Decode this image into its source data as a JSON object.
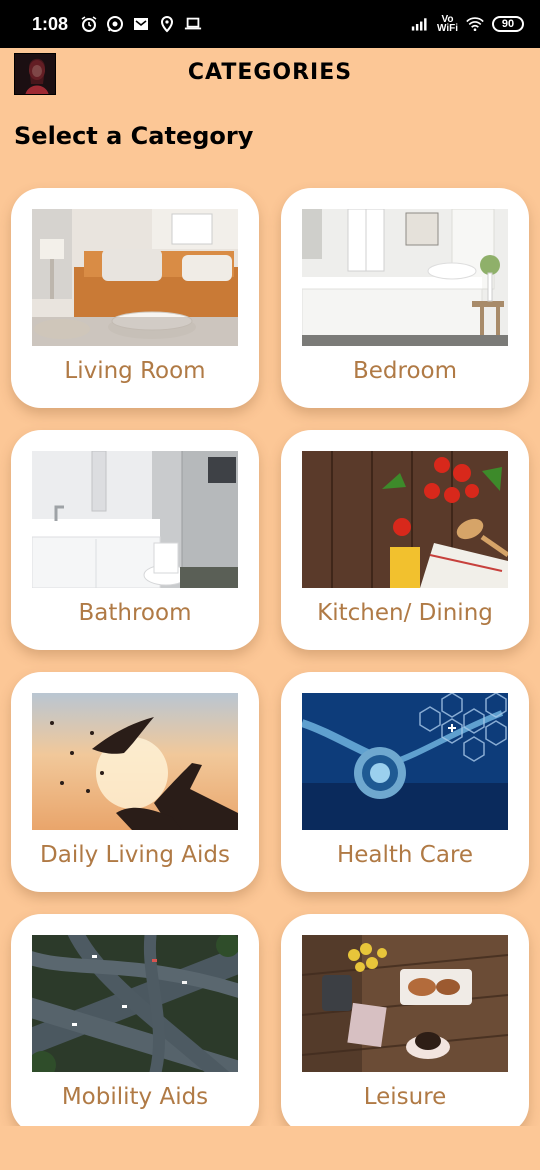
{
  "status_bar": {
    "time": "1:08",
    "volte_top": "Vo",
    "volte_bottom": "WiFi",
    "battery": "90"
  },
  "header": {
    "title": "CATEGORIES"
  },
  "section_title": "Select a Category",
  "categories": [
    {
      "label": "Living Room"
    },
    {
      "label": "Bedroom"
    },
    {
      "label": "Bathroom"
    },
    {
      "label": "Kitchen/ Dining"
    },
    {
      "label": "Daily Living Aids"
    },
    {
      "label": "Health Care"
    },
    {
      "label": "Mobility Aids"
    },
    {
      "label": "Leisure"
    }
  ],
  "colors": {
    "background": "#fcc796",
    "label": "#b07a45",
    "card": "#ffffff"
  }
}
